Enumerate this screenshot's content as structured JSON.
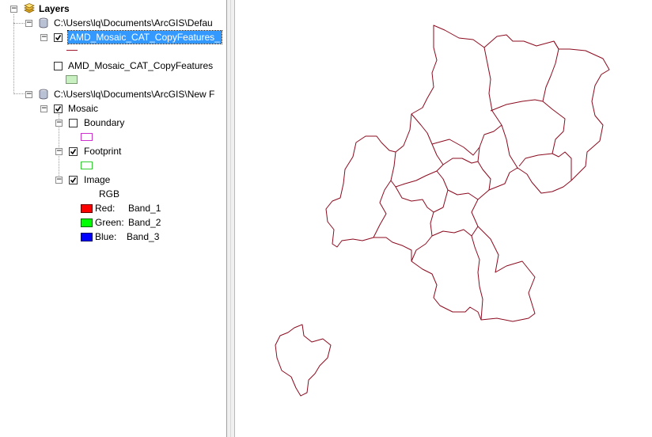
{
  "toc": {
    "root": {
      "label": "Layers"
    },
    "groups": [
      {
        "path": "C:\\Users\\lq\\Documents\\ArcGIS\\Defau",
        "layers": [
          {
            "label": "AMD_Mosaic_CAT_CopyFeatures_",
            "checked": true,
            "selected": true,
            "symbol": "line",
            "symbol_color": "#a0182e"
          },
          {
            "label": "AMD_Mosaic_CAT_CopyFeatures",
            "checked": false,
            "selected": false,
            "symbol": "fill",
            "symbol_color": "#c8f0c0"
          }
        ]
      },
      {
        "path": "C:\\Users\\lq\\Documents\\ArcGIS\\New F",
        "mosaic": {
          "label": "Mosaic",
          "checked": true,
          "sublayers": [
            {
              "label": "Boundary",
              "checked": false,
              "symbol_color": "#cc33cc"
            },
            {
              "label": "Footprint",
              "checked": true,
              "symbol_color": "#33cc33"
            },
            {
              "label": "Image",
              "checked": true
            }
          ],
          "image_legend": {
            "title": "RGB",
            "bands": [
              {
                "channel": "Red:",
                "band": "Band_1",
                "color": "#ff0000"
              },
              {
                "channel": "Green:",
                "band": "Band_2",
                "color": "#00ff00"
              },
              {
                "channel": "Blue:",
                "band": "Band_3",
                "color": "#0000ff"
              }
            ]
          }
        }
      }
    ]
  },
  "map": {
    "outline_color": "#8b0a1e"
  }
}
